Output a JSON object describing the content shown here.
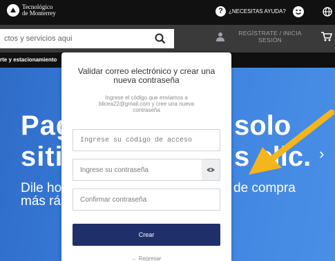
{
  "header": {
    "logo_line1": "Tecnológico",
    "logo_line2": "de Monterrey",
    "help_label": "¿NECESITAS AYUDA?"
  },
  "search": {
    "placeholder": "ctos y servicios aqui"
  },
  "account": {
    "register_line1": "REGÍSTRATE / INICIA",
    "register_line2": "SESIÓN"
  },
  "nav": {
    "label": "rte y estacionamiento"
  },
  "hero": {
    "line1": "Pag",
    "line2": "sitic",
    "line3": "solo",
    "line4": "s clic.",
    "sub1": "Dile ho",
    "sub2": "más rá",
    "sub3": "de compra",
    "next_glyph": "›"
  },
  "modal": {
    "title": "Validar correo electrónico y crear una nueva contraseña",
    "description": "Ingrese el código que enviamos a blicea22@gmail.com y cree una nueva contraseña",
    "code_placeholder": "Ingrese su código de acceso",
    "password_placeholder": "Ingrese su contraseña",
    "confirm_placeholder": "Confirmar contraseña",
    "create_label": "Crear",
    "back_label": "← Regresar"
  },
  "colors": {
    "topbar": "#111111",
    "hero": "#3b80de",
    "button": "#1f2f6a",
    "arrow": "#f5b51c"
  },
  "icons": [
    "logo-icon",
    "help-icon",
    "face-icon",
    "globe-icon",
    "search-icon",
    "user-icon",
    "cart-icon",
    "eye-icon",
    "chevron-right-icon",
    "annotation-arrow"
  ]
}
